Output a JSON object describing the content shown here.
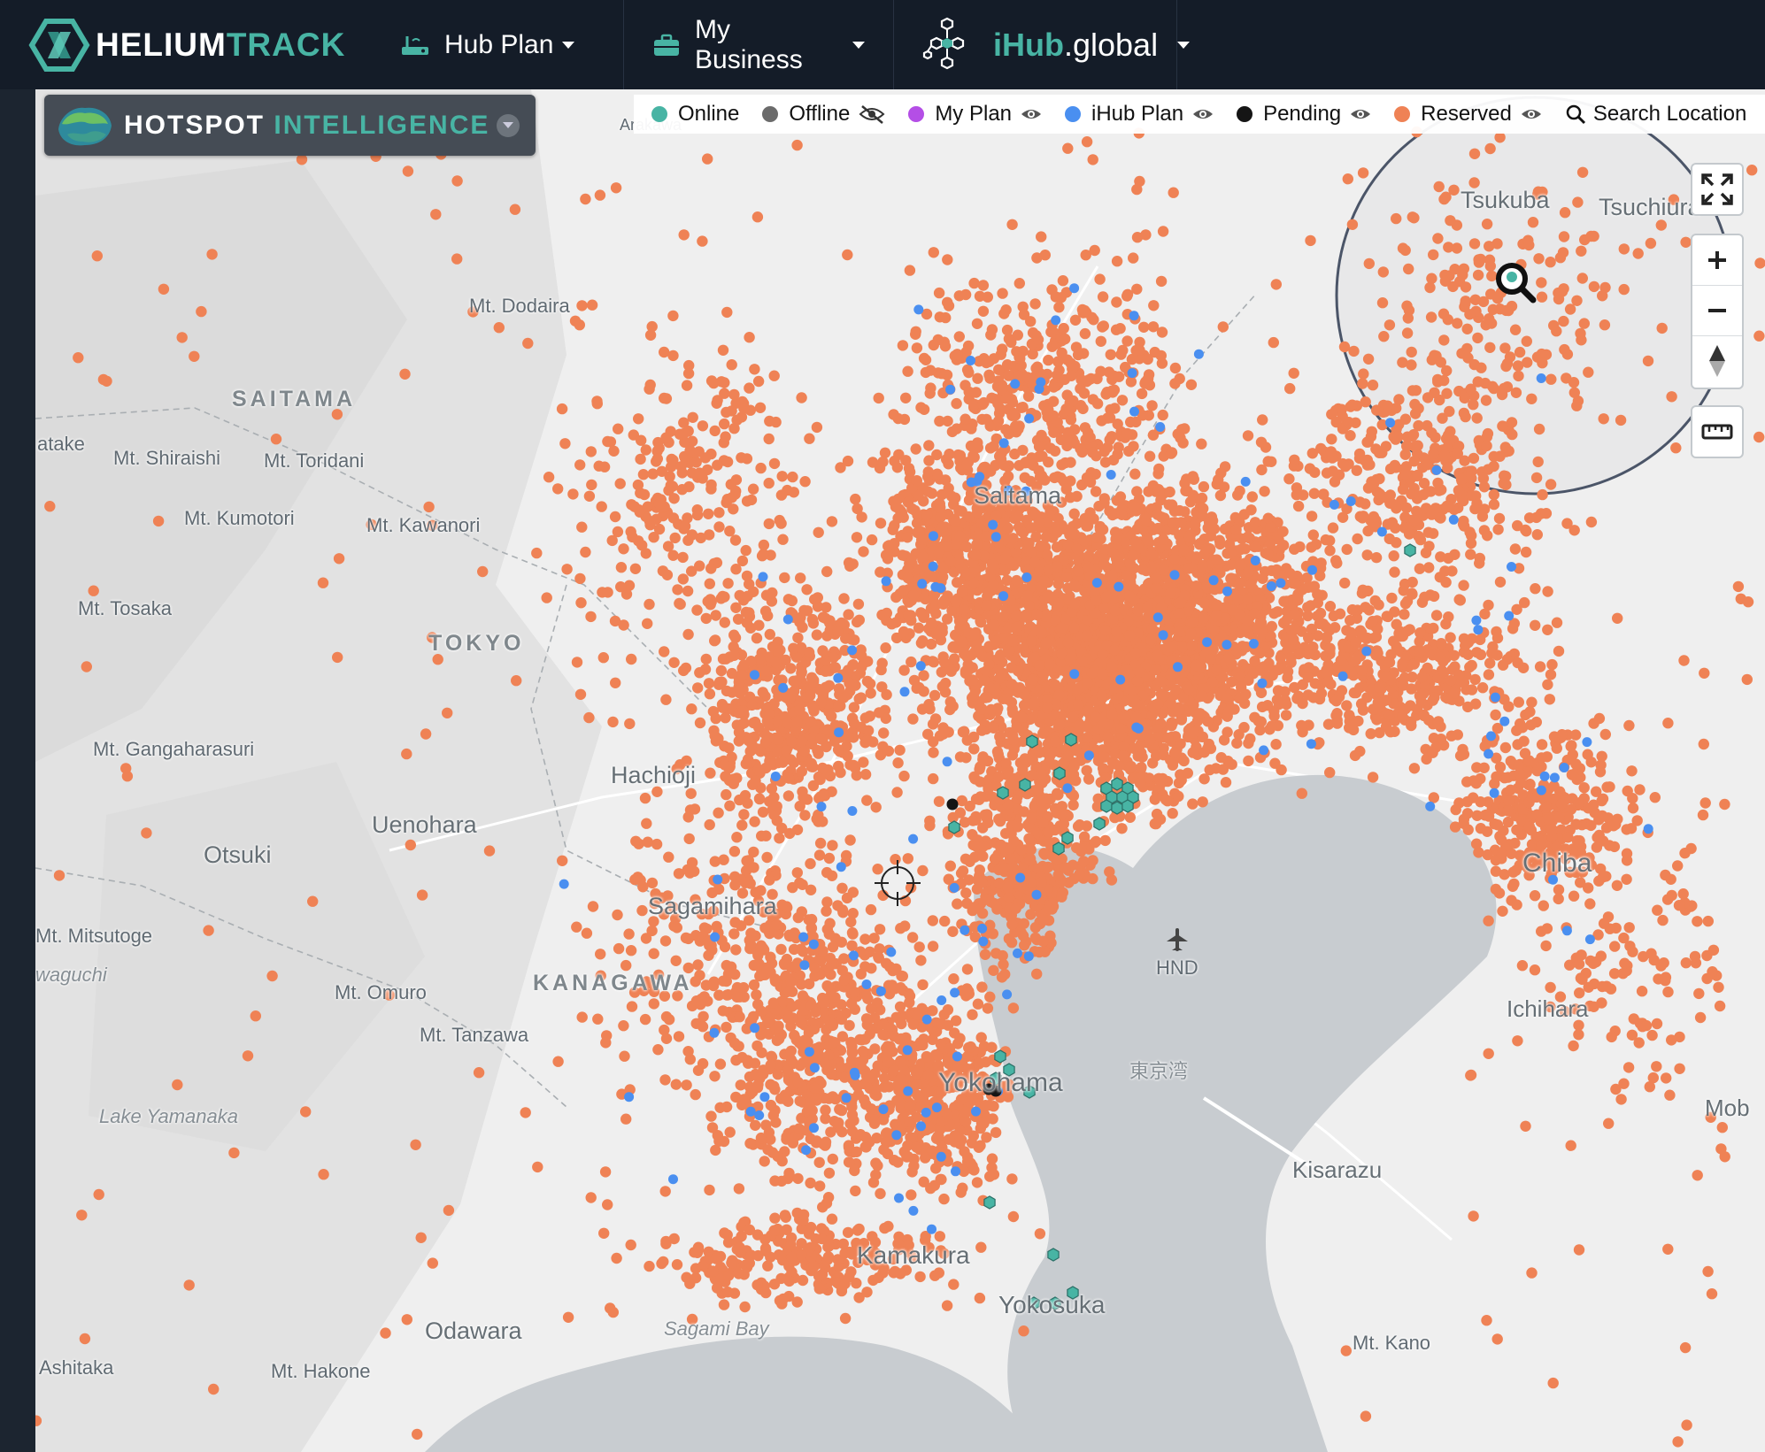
{
  "navbar": {
    "brand_a": "HELIUM",
    "brand_b": "TRACK",
    "hub_plan": "Hub Plan",
    "my_business": "My Business",
    "ihub_i": "iHub",
    "ihub_g": ".global"
  },
  "panel": {
    "title_a": "HOTSPOT",
    "title_b": "INTELLIGENCE"
  },
  "legend": {
    "online": "Online",
    "offline": "Offline",
    "my_plan": "My Plan",
    "ihub_plan": "iHub Plan",
    "pending": "Pending",
    "reserved": "Reserved",
    "search": "Search Location"
  },
  "colors": {
    "online": "#48b4a4",
    "offline": "#6b6b6b",
    "my_plan": "#b44ee6",
    "ihub_plan": "#4a8ff0",
    "pending": "#151515",
    "reserved": "#ef8255",
    "navbar": "#141c28"
  },
  "map_labels": {
    "saitama": "SAITAMA",
    "tokyo": "TOKYO",
    "kanagawa": "KANAGAWA",
    "mt_dodaira": "Mt. Dodaira",
    "atake": "atake",
    "mt_shiraishi": "Mt. Shiraishi",
    "mt_toridani": "Mt. Toridani",
    "mt_kumotori": "Mt. Kumotori",
    "mt_kawanori": "Mt. Kawanori",
    "mt_tosaka": "Mt. Tosaka",
    "mt_gangaharasuri": "Mt. Gangaharasuri",
    "uenohara": "Uenohara",
    "otsuki": "Otsuki",
    "mt_mitsutoge": "Mt. Mitsutoge",
    "waguchi": "waguchi",
    "mt_omuro": "Mt. Omuro",
    "mt_tanzawa": "Mt. Tanzawa",
    "lake_yamanaka": "Lake Yamanaka",
    "ashitaka": "Ashitaka",
    "mt_hakone": "Mt. Hakone",
    "odawara": "Odawara",
    "sagami_bay": "Sagami Bay",
    "yokohama": "Yokohama",
    "yokosuka": "Yokosuka",
    "kamakura": "Kamakura",
    "hnd": "HND",
    "tokyo_bay": "東京湾",
    "chiba": "Chiba",
    "ichihara": "Ichihara",
    "kisarazu": "Kisarazu",
    "mt_kano": "Mt. Kano",
    "mob": "Mob",
    "tsukuba": "Tsukuba",
    "tsuchiura": "Tsuchiura",
    "hachioji": "Hachioji",
    "sagamihara": "Sagamihara",
    "saitama_city": "Saitama",
    "arakawa": "Arakawa"
  },
  "map_state": {
    "search_marker": "search-location-pin",
    "crosshair": "center-crosshair"
  }
}
